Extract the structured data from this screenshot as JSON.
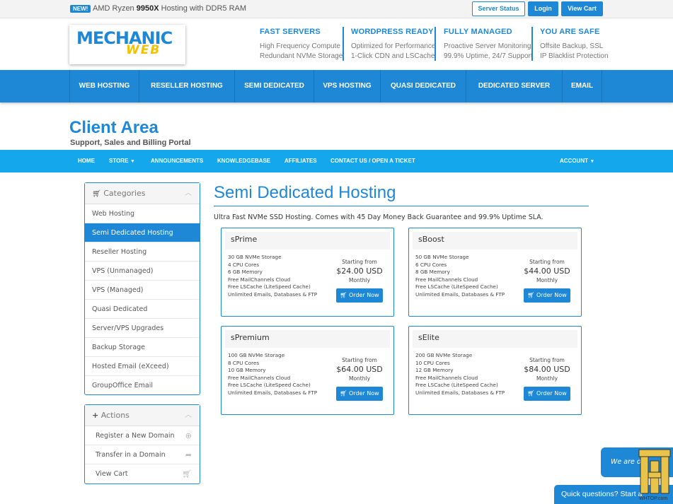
{
  "topbar": {
    "badge": "NEW!",
    "announce_pre": "AMD Ryzen ",
    "announce_bold": "9950X",
    "announce_post": " Hosting with DDR5 RAM",
    "server_status": "Server Status",
    "login": "Login",
    "view_cart": "View Cart"
  },
  "logo": {
    "line1": "MECHANIC",
    "line2": "WEB"
  },
  "features": [
    {
      "title": "FAST SERVERS",
      "line1": "High Frequency Compute",
      "line2": "Redundant NVMe Storage"
    },
    {
      "title": "WORDPRESS READY",
      "line1": "Optimized for Performance",
      "line2": "1-Click CDN and LSCache"
    },
    {
      "title": "FULLY MANAGED",
      "line1": "Proactive Server Monitoring",
      "line2": "99.9% Uptime, 24/7 Support"
    },
    {
      "title": "YOU ARE SAFE",
      "line1": "Offsite Backup, SSL",
      "line2": "IP Blacklist Protection"
    }
  ],
  "main_nav": [
    "WEB HOSTING",
    "RESELLER HOSTING",
    "SEMI DEDICATED",
    "VPS HOSTING",
    "QUASI DEDICATED",
    "DEDICATED SERVER",
    "EMAIL"
  ],
  "client": {
    "title": "Client Area",
    "subtitle": "Support, Sales and Billing Portal"
  },
  "sub_nav": {
    "home": "HOME",
    "store": "STORE",
    "announcements": "ANNOUNCEMENTS",
    "knowledgebase": "KNOWLEDGEBASE",
    "affiliates": "AFFILIATES",
    "contact": "CONTACT US / OPEN A TICKET",
    "account": "ACCOUNT"
  },
  "categories": {
    "title": "Categories",
    "items": [
      "Web Hosting",
      "Semi Dedicated Hosting",
      "Reseller Hosting",
      "VPS (Unmanaged)",
      "VPS (Managed)",
      "Quasi Dedicated",
      "Server/VPS Upgrades",
      "Backup Storage",
      "Hosted Email (eXceed)",
      "GroupOffice Email"
    ],
    "active_index": 1
  },
  "actions": {
    "title": "Actions",
    "items": [
      {
        "label": "Register a New Domain",
        "icon": "globe-icon"
      },
      {
        "label": "Transfer in a Domain",
        "icon": "share-arrow-icon"
      },
      {
        "label": "View Cart",
        "icon": "cart-icon"
      }
    ]
  },
  "content": {
    "title": "Semi Dedicated Hosting",
    "description": "Ultra Fast NVMe SSD Hosting. Comes with 45 Day Money Back Guarantee and 99.9% Uptime SLA."
  },
  "products": [
    {
      "name": "sPrime",
      "features": [
        "30 GB NVMe Storage",
        "4 CPU Cores",
        "6 GB Memory",
        "Free MailChannels Cloud",
        "Free LSCache (LiteSpeed Cache)",
        "Unlimited Emails, Databases & FTP"
      ],
      "starting": "Starting from",
      "price": "$24.00 USD",
      "period": "Monthly",
      "order": "Order Now"
    },
    {
      "name": "sBoost",
      "features": [
        "50 GB NVMe Storage",
        "6 CPU Cores",
        "8 GB Memory",
        "Free MailChannels Cloud",
        "Free LSCache (LiteSpeed Cache)",
        "Unlimited Emails, Databases & FTP"
      ],
      "starting": "Starting from",
      "price": "$44.00 USD",
      "period": "Monthly",
      "order": "Order Now"
    },
    {
      "name": "sPremium",
      "features": [
        "100 GB NVMe Storage",
        "8 CPU Cores",
        "10 GB Memory",
        "Free MailChannels Cloud",
        "Free LSCache (LiteSpeed Cache)",
        "Unlimited Emails, Databases & FTP"
      ],
      "starting": "Starting from",
      "price": "$64.00 USD",
      "period": "Monthly",
      "order": "Order Now"
    },
    {
      "name": "sElite",
      "features": [
        "200 GB NVMe Storage",
        "10 CPU Cores",
        "12 GB Memory",
        "Free MailChannels Cloud",
        "Free LSCache (LiteSpeed Cache)",
        "Unlimited Emails, Databases & FTP"
      ],
      "starting": "Starting from",
      "price": "$84.00 USD",
      "period": "Monthly",
      "order": "Order Now"
    }
  ],
  "chat": {
    "bubble": "We are o",
    "bar": "Quick questions? Start a"
  },
  "watermark": {
    "text": "WHTOP.com"
  },
  "colors": {
    "brand": "#1e88d6",
    "subnav": "#14a7ec",
    "logo_yellow": "#f2c200"
  }
}
